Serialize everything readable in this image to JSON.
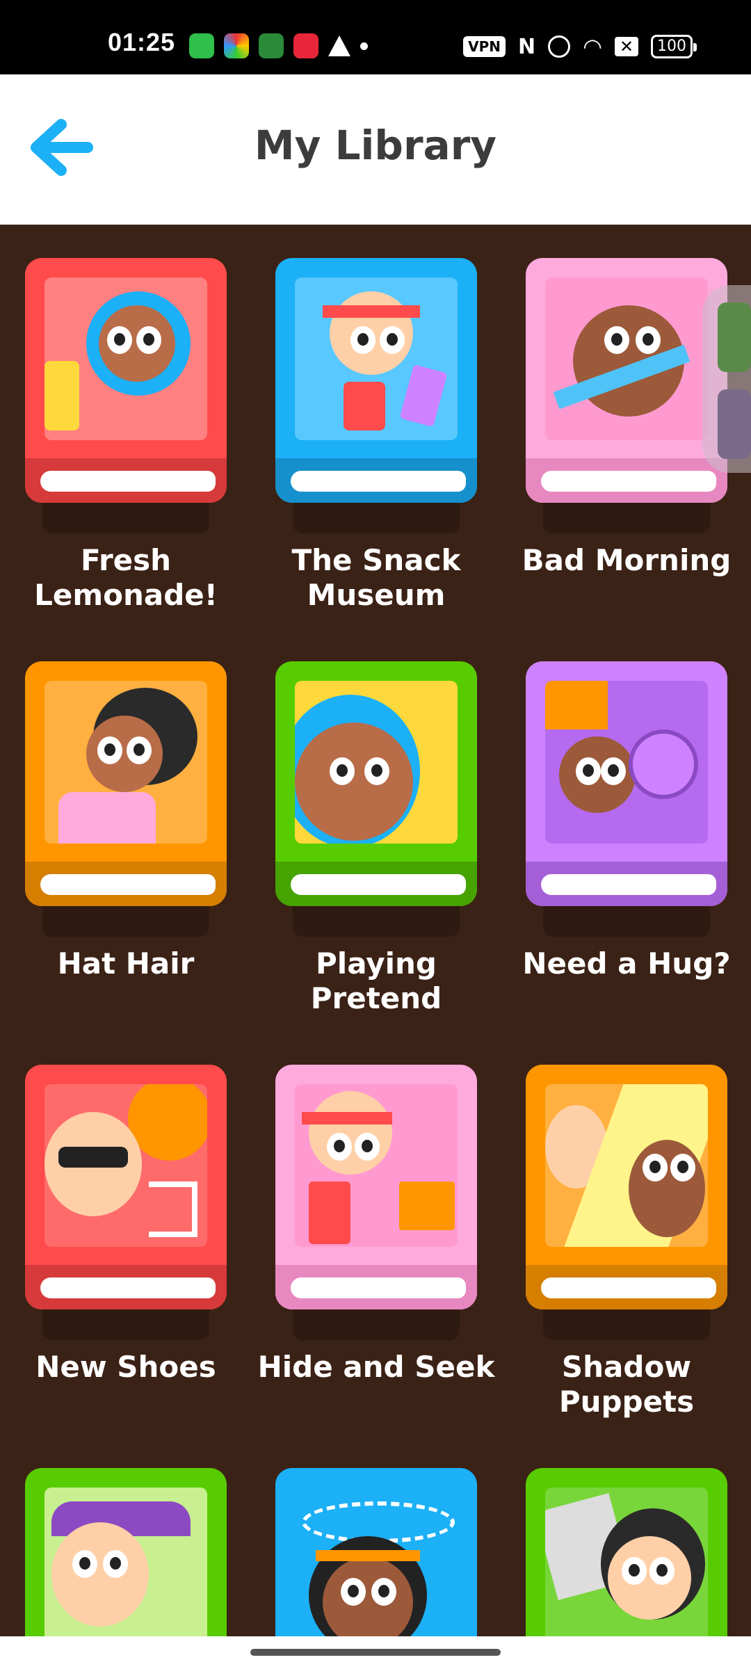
{
  "status_bar": {
    "time": "01:25",
    "vpn": "VPN",
    "nfc": "N",
    "battery": "100"
  },
  "header": {
    "title": "My Library",
    "back_icon": "back-arrow-icon"
  },
  "colors": {
    "background": "#3b2216",
    "accent": "#1cb0f6",
    "red": "#ff4b4b",
    "blue": "#1cb0f6",
    "pink": "#ffaadd",
    "orange": "#ff9600",
    "green": "#58cc02",
    "purple": "#ce82ff"
  },
  "books": [
    {
      "title": "Fresh Lemonade!",
      "color": "red"
    },
    {
      "title": "The Snack Museum",
      "color": "blue"
    },
    {
      "title": "Bad Morning",
      "color": "pink"
    },
    {
      "title": "Hat Hair",
      "color": "orange"
    },
    {
      "title": "Playing Pretend",
      "color": "green"
    },
    {
      "title": "Need a Hug?",
      "color": "purple"
    },
    {
      "title": "New Shoes",
      "color": "red"
    },
    {
      "title": "Hide and Seek",
      "color": "pink"
    },
    {
      "title": "Shadow Puppets",
      "color": "orange"
    },
    {
      "title": "",
      "color": "green"
    },
    {
      "title": "",
      "color": "blue"
    },
    {
      "title": "",
      "color": "green"
    }
  ]
}
